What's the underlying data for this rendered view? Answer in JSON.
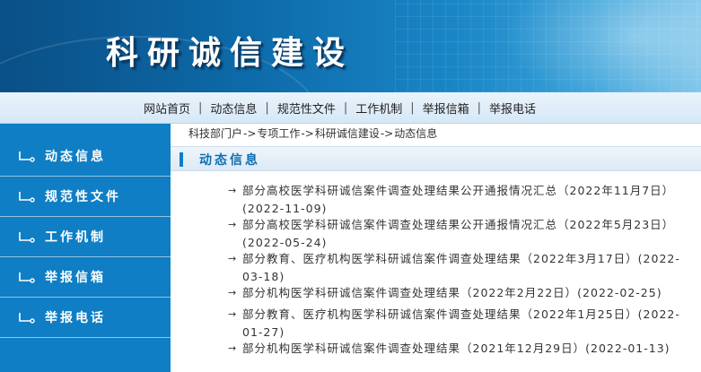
{
  "banner": {
    "title": "科研诚信建设"
  },
  "nav": {
    "items": [
      "网站首页",
      "动态信息",
      "规范性文件",
      "工作机制",
      "举报信箱",
      "举报电话"
    ],
    "separator": "|"
  },
  "sidebar": {
    "items": [
      "动态信息",
      "规范性文件",
      "工作机制",
      "举报信箱",
      "举报电话"
    ]
  },
  "breadcrumb": {
    "items": [
      "科技部门户",
      "专项工作",
      "科研诚信建设",
      "动态信息"
    ],
    "separator": "->"
  },
  "section": {
    "title": "动态信息"
  },
  "news": {
    "arrow": "→",
    "items": [
      {
        "title": "部分高校医学科研诚信案件调查处理结果公开通报情况汇总（2022年11月7日）",
        "date": "(2022-11-09)"
      },
      {
        "title": "部分高校医学科研诚信案件调查处理结果公开通报情况汇总（2022年5月23日）",
        "date": "(2022-05-24)"
      },
      {
        "title": "部分教育、医疗机构医学科研诚信案件调查处理结果（2022年3月17日）",
        "date": "(2022-03-18)"
      },
      {
        "title": "部分机构医学科研诚信案件调查处理结果（2022年2月22日）",
        "date": "(2022-02-25)"
      },
      {
        "title": "部分教育、医疗机构医学科研诚信案件调查处理结果（2022年1月25日）",
        "date": "(2022-01-27)"
      },
      {
        "title": "部分机构医学科研诚信案件调查处理结果（2021年12月29日）",
        "date": "(2022-01-13)"
      }
    ]
  },
  "colors": {
    "banner_dark": "#0a4f86",
    "sidebar_bg": "#0f7ec4",
    "section_title": "#0f6fb0",
    "nav_bg": "#d6e8f6"
  }
}
